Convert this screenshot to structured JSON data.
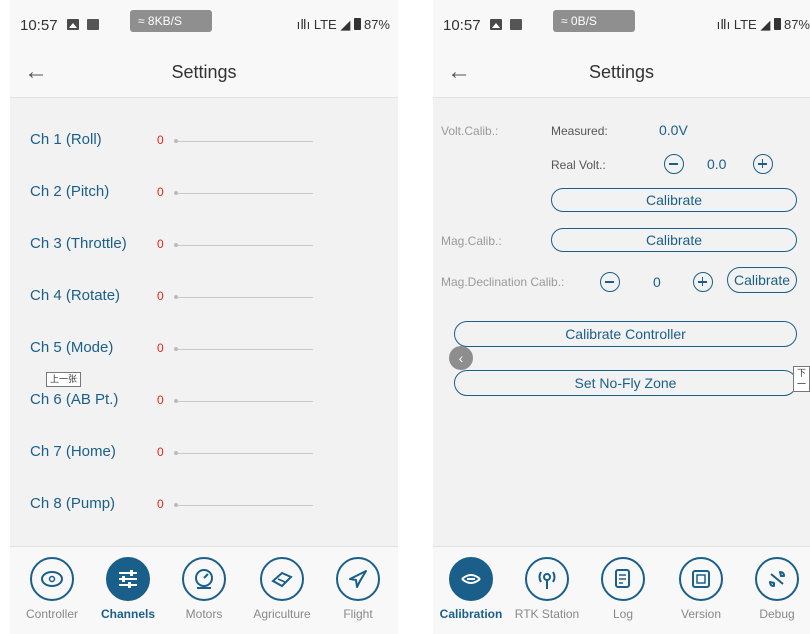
{
  "left": {
    "status": {
      "time": "10:57",
      "net_speed": "8KB/S",
      "signal": "LTE",
      "battery": "87%"
    },
    "title": "Settings",
    "channels": [
      {
        "label": "Ch 1 (Roll)",
        "value": "0"
      },
      {
        "label": "Ch 2 (Pitch)",
        "value": "0"
      },
      {
        "label": "Ch 3 (Throttle)",
        "value": "0"
      },
      {
        "label": "Ch 4 (Rotate)",
        "value": "0"
      },
      {
        "label": "Ch 5 (Mode)",
        "value": "0"
      },
      {
        "label": "Ch 6 (AB Pt.)",
        "value": "0"
      },
      {
        "label": "Ch 7 (Home)",
        "value": "0"
      },
      {
        "label": "Ch 8 (Pump)",
        "value": "0"
      }
    ],
    "tooltip": "上一张",
    "nav": [
      {
        "label": "Controller",
        "icon": "gamepad-icon"
      },
      {
        "label": "Channels",
        "icon": "sliders-icon",
        "active": true
      },
      {
        "label": "Motors",
        "icon": "motor-icon"
      },
      {
        "label": "Agriculture",
        "icon": "spray-icon"
      },
      {
        "label": "Flight",
        "icon": "airplane-icon"
      }
    ]
  },
  "right": {
    "status": {
      "time": "10:57",
      "net_speed": "0B/S",
      "signal": "LTE",
      "battery": "87%"
    },
    "title": "Settings",
    "volt": {
      "label": "Volt.Calib.:",
      "measured_label": "Measured:",
      "measured_value": "0.0V",
      "real_label": "Real Volt.:",
      "real_value": "0.0",
      "button": "Calibrate"
    },
    "mag": {
      "label": "Mag.Calib.:",
      "button": "Calibrate"
    },
    "decl": {
      "label": "Mag.Declination Calib.:",
      "value": "0",
      "button": "Calibrate"
    },
    "controller_button": "Calibrate Controller",
    "nofly_button": "Set No-Fly Zone",
    "tooltip": "下一",
    "nav": [
      {
        "label": "Calibration",
        "icon": "calibration-icon",
        "active": true
      },
      {
        "label": "RTK Station",
        "icon": "rtk-icon"
      },
      {
        "label": "Log",
        "icon": "log-icon"
      },
      {
        "label": "Version",
        "icon": "version-icon"
      },
      {
        "label": "Debug",
        "icon": "wrench-icon"
      }
    ]
  },
  "colors": {
    "accent": "#1a5f8a",
    "value_red": "#e0281c"
  }
}
